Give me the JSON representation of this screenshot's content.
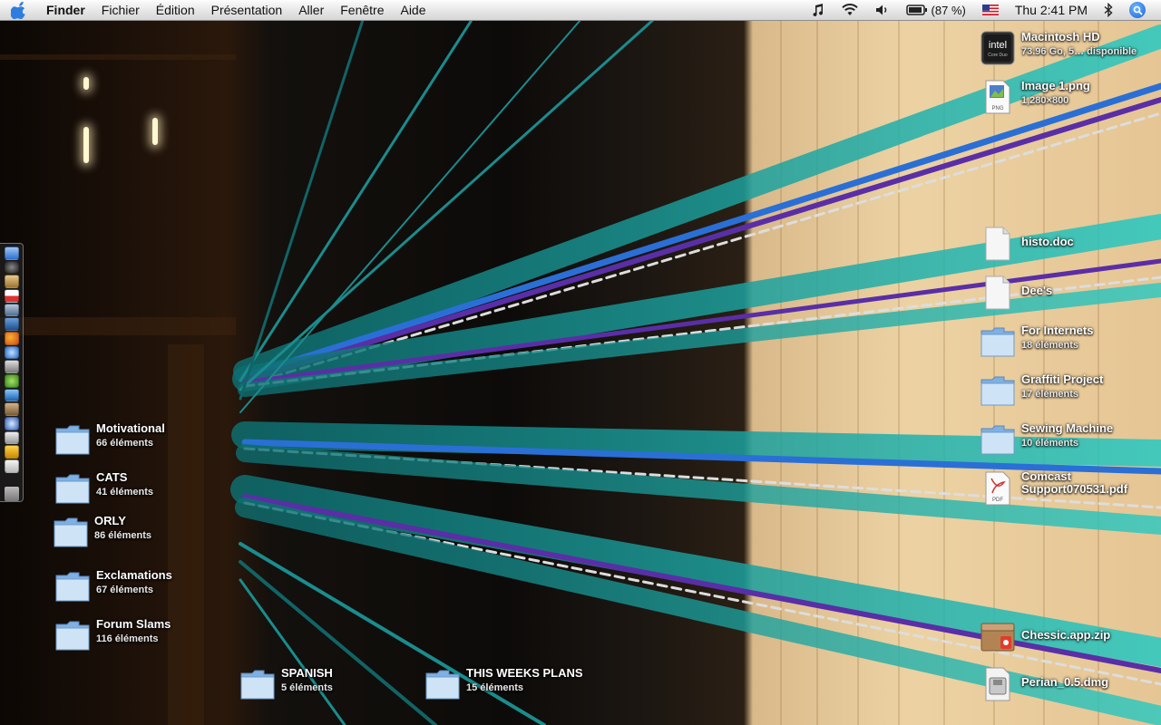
{
  "menubar": {
    "app_name": "Finder",
    "menus": [
      "Fichier",
      "Édition",
      "Présentation",
      "Aller",
      "Fenêtre",
      "Aide"
    ],
    "battery_percent": "(87 %)",
    "clock": "Thu 2:41 PM"
  },
  "drive": {
    "name": "Macintosh HD",
    "info": "73.96 Go, 5… disponible",
    "badge_top": "intel",
    "badge_bottom": "Core Duo"
  },
  "right_items": {
    "image1": {
      "name": "Image 1.png",
      "info": "1,280×800",
      "icon_label": "PNG"
    },
    "histo": {
      "name": "histo.doc"
    },
    "dees": {
      "name": "Dee's"
    },
    "internets": {
      "name": "For Internets",
      "info": "18 éléments"
    },
    "graffiti": {
      "name": "Graffiti Project",
      "info": "17 éléments"
    },
    "sewing": {
      "name": "Sewing Machine",
      "info": "10 éléments"
    },
    "comcast": {
      "name": "Comcast Support070531.pdf",
      "icon_label": "PDF"
    },
    "chessic": {
      "name": "Chessic.app.zip"
    },
    "perian": {
      "name": "Perian_0.5.dmg"
    }
  },
  "left_folders": {
    "motivational": {
      "name": "Motivational",
      "info": "66 éléments"
    },
    "cats": {
      "name": "CATS",
      "info": "41 éléments"
    },
    "orly": {
      "name": "ORLY",
      "info": "86 éléments"
    },
    "exclamations": {
      "name": "Exclamations",
      "info": "67 éléments"
    },
    "forum": {
      "name": "Forum Slams",
      "info": "116 éléments"
    }
  },
  "bottom_folders": {
    "spanish": {
      "name": "SPANISH",
      "info": "5 éléments"
    },
    "plans": {
      "name": "THIS WEEKS PLANS",
      "info": "15 éléments"
    }
  },
  "colors": {
    "folder_light": "#cfe3f7",
    "folder_dark": "#7fb0e3",
    "thread_teal": "#1fb5b0",
    "thread_blue": "#2a6fd6",
    "thread_purple": "#5a2ea6"
  },
  "dock_icons": [
    "finder-icon",
    "dashboard-icon",
    "ical-icon",
    "calendar-icon",
    "system-prefs-icon",
    "iphoto-icon",
    "firefox-icon",
    "safari-icon",
    "widget-icon",
    "itunes-icon",
    "mail-icon",
    "address-icon",
    "network-icon",
    "script-icon",
    "money-icon",
    "utility-icon"
  ]
}
